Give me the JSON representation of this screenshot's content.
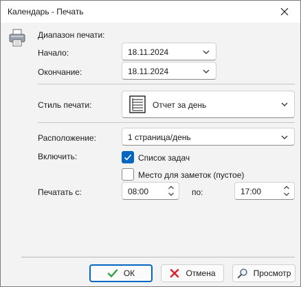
{
  "window": {
    "title": "Календарь - Печать"
  },
  "range": {
    "heading": "Диапазон печати:",
    "start_label": "Начало:",
    "start_value": "18.11.2024",
    "end_label": "Окончание:",
    "end_value": "18.11.2024"
  },
  "style": {
    "label": "Стиль печати:",
    "value": "Отчет за день"
  },
  "layout": {
    "label": "Расположение:",
    "value": "1 страница/день"
  },
  "include": {
    "label": "Включить:",
    "task_list": {
      "label": "Список задач",
      "checked": true
    },
    "notes_area": {
      "label": "Место для заметок (пустое)",
      "checked": false
    }
  },
  "print_from": {
    "label": "Печатать с:",
    "from_value": "08:00",
    "to_label": "по:",
    "to_value": "17:00"
  },
  "buttons": {
    "ok": "ОК",
    "cancel": "Отмена",
    "preview": "Просмотр"
  },
  "colors": {
    "accent": "#0067c0",
    "ok_check": "#2e9e3e",
    "cancel_x": "#d9272e"
  }
}
